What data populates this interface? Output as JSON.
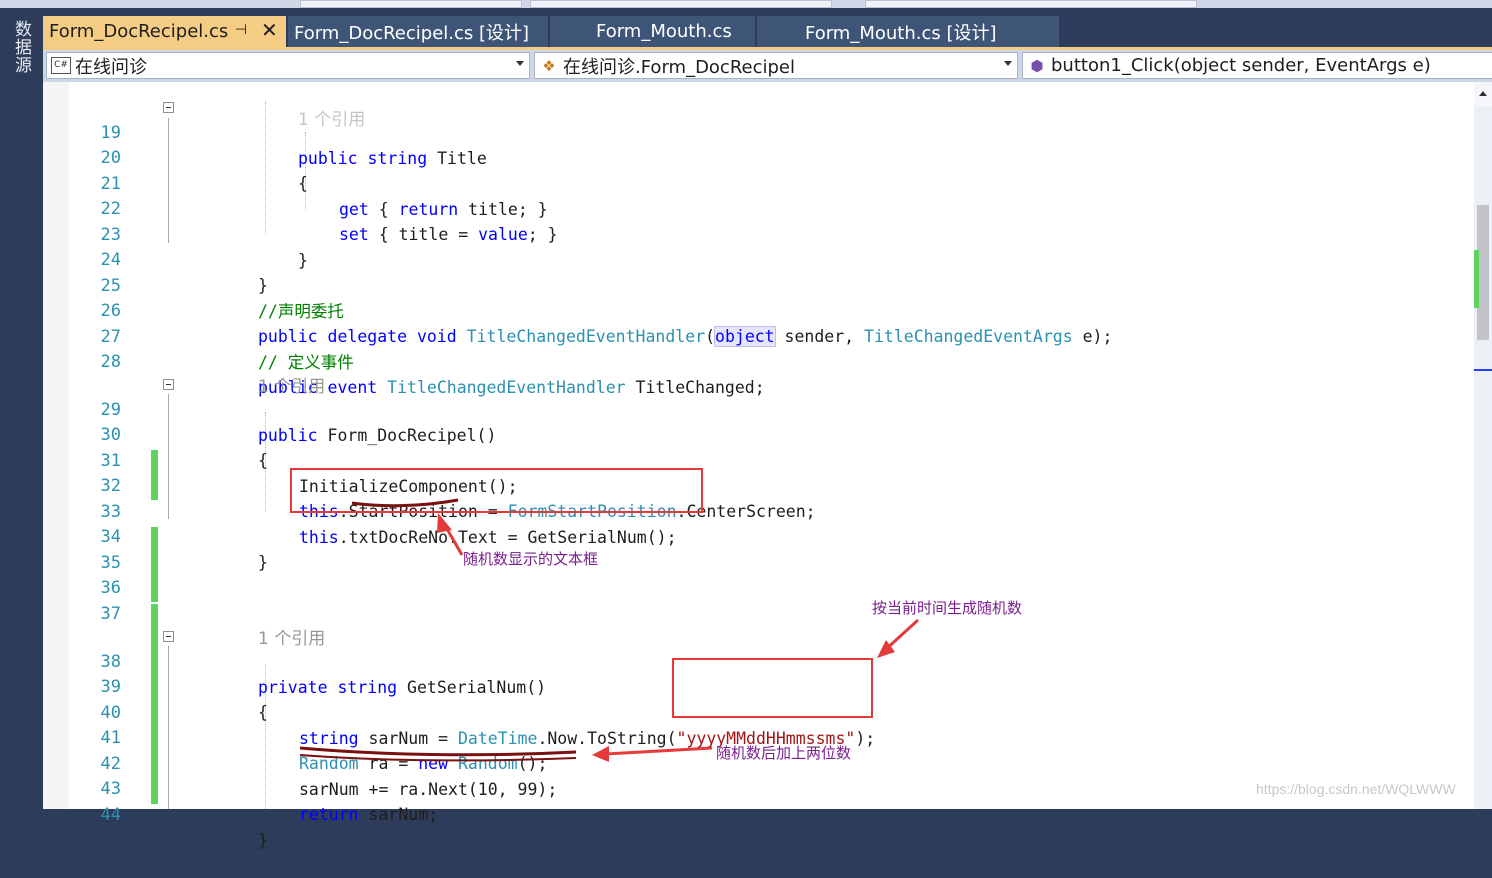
{
  "sidebar": {
    "label": "数据源"
  },
  "tabs": [
    {
      "label": "Form_DocRecipel.cs",
      "active": true
    },
    {
      "label": "Form_DocRecipel.cs [设计]",
      "active": false
    },
    {
      "label": "Form_Mouth.cs",
      "active": false
    },
    {
      "label": "Form_Mouth.cs [设计]",
      "active": false
    }
  ],
  "tab_icons": {
    "pin": "pin-icon",
    "close": "close-icon"
  },
  "nav": {
    "project": "在线问诊",
    "class": "在线问诊.Form_DocRecipel",
    "member": "button1_Click(object sender, EventArgs e)",
    "project_icon_text": "C#"
  },
  "code_lines": [
    {
      "num": "19",
      "text": "public string Title"
    },
    {
      "num": "20",
      "text": "{"
    },
    {
      "num": "21",
      "text": "get { return title; }"
    },
    {
      "num": "22",
      "text": "set { title = value; }"
    },
    {
      "num": "23",
      "text": "}"
    },
    {
      "num": "24",
      "text": "}"
    },
    {
      "num": "25",
      "text": "//声明委托"
    },
    {
      "num": "26",
      "text": "public delegate void TitleChangedEventHandler(object sender, TitleChangedEventArgs e);"
    },
    {
      "num": "27",
      "text": "// 定义事件"
    },
    {
      "num": "28",
      "text": "public event TitleChangedEventHandler TitleChanged;"
    },
    {
      "num": "29",
      "text": "public Form_DocRecipel()"
    },
    {
      "num": "30",
      "text": "{"
    },
    {
      "num": "31",
      "text": "InitializeComponent();"
    },
    {
      "num": "32",
      "text": "this.StartPosition = FormStartPosition.CenterScreen;"
    },
    {
      "num": "33",
      "text": "this.txtDocReNo.Text = GetSerialNum();"
    },
    {
      "num": "34",
      "text": "}"
    },
    {
      "num": "35",
      "text": ""
    },
    {
      "num": "36",
      "text": ""
    },
    {
      "num": "37",
      "text": ""
    },
    {
      "num": "38",
      "text": "private string GetSerialNum()"
    },
    {
      "num": "39",
      "text": "{"
    },
    {
      "num": "40",
      "text": "string sarNum = DateTime.Now.ToString(\"yyyyMMddHHmmssms\");"
    },
    {
      "num": "41",
      "text": "Random ra = new Random();"
    },
    {
      "num": "42",
      "text": "sarNum += ra.Next(10, 99);"
    },
    {
      "num": "43",
      "text": "return sarNum;"
    },
    {
      "num": "44",
      "text": "}"
    }
  ],
  "ref_label": "1 个引用",
  "annotations": {
    "textbox": "随机数显示的文本框",
    "time": "按当前时间生成随机数",
    "suffix": "随机数后加上两位数"
  },
  "watermark": "https://blog.csdn.net/WQLWWW"
}
